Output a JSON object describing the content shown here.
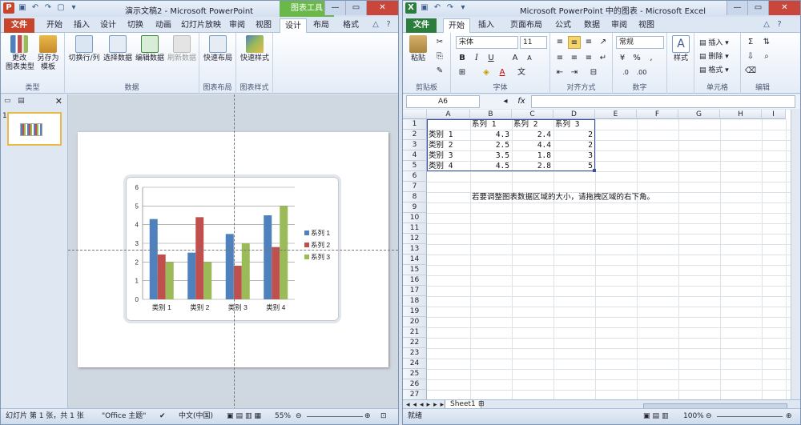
{
  "ppt": {
    "title": "演示文稿2 - Microsoft PowerPoint",
    "context_tab": "图表工具",
    "tabs": [
      "文件",
      "开始",
      "插入",
      "设计",
      "切换",
      "动画",
      "幻灯片放映",
      "审阅",
      "视图",
      "设计",
      "布局",
      "格式"
    ],
    "selected_tab_index": 9,
    "groups": {
      "type": {
        "label": "类型",
        "btn1": "更改\n图表类型",
        "btn2": "另存为\n模板"
      },
      "data": {
        "label": "数据",
        "btn1": "切换行/列",
        "btn2": "选择数据",
        "btn3": "编辑数据",
        "btn4": "刷新数据"
      },
      "layout": {
        "label": "图表布局",
        "btn1": "快速布局"
      },
      "style": {
        "label": "图表样式",
        "btn1": "快速样式"
      }
    },
    "slide_number": "1",
    "status": {
      "slide": "幻灯片 第 1 张，共 1 张",
      "theme": "\"Office 主题\"",
      "lang": "中文(中国)",
      "zoom": "55%"
    }
  },
  "xl": {
    "title": "Microsoft PowerPoint 中的图表 - Microsoft Excel",
    "tabs": [
      "文件",
      "开始",
      "插入",
      "页面布局",
      "公式",
      "数据",
      "审阅",
      "视图"
    ],
    "selected_tab_index": 1,
    "font_name": "宋体",
    "font_size": "11",
    "number_format": "常规",
    "groups": {
      "clipboard": "剪贴板",
      "font": "字体",
      "align": "对齐方式",
      "number": "数字",
      "style_btn": "样式",
      "cells": "单元格",
      "editing": "编辑",
      "paste": "粘贴",
      "insert": "插入",
      "delete": "删除",
      "format": "格式"
    },
    "name_box": "A6",
    "fx": "fx",
    "columns": [
      "A",
      "B",
      "C",
      "D",
      "E",
      "F",
      "G",
      "H",
      "I"
    ],
    "rows": [
      "1",
      "2",
      "3",
      "4",
      "5",
      "6",
      "7",
      "8",
      "9",
      "10",
      "11",
      "12",
      "13",
      "14",
      "15",
      "16",
      "17",
      "18",
      "19",
      "20",
      "21",
      "22",
      "23",
      "24",
      "25",
      "26",
      "27"
    ],
    "cells": {
      "B1": "系列 1",
      "C1": "系列 2",
      "D1": "系列 3",
      "A2": "类别 1",
      "B2": "4.3",
      "C2": "2.4",
      "D2": "2",
      "A3": "类别 2",
      "B3": "2.5",
      "C3": "4.4",
      "D3": "2",
      "A4": "类别 3",
      "B4": "3.5",
      "C4": "1.8",
      "D4": "3",
      "A5": "类别 4",
      "B5": "4.5",
      "C5": "2.8",
      "D5": "5",
      "B8": "若要调整图表数据区域的大小，请拖拽区域的右下角。"
    },
    "sheet_tab": "Sheet1",
    "status": {
      "ready": "就绪",
      "zoom": "100%"
    }
  },
  "chart_data": {
    "type": "bar",
    "categories": [
      "类别 1",
      "类别 2",
      "类别 3",
      "类别 4"
    ],
    "series": [
      {
        "name": "系列 1",
        "values": [
          4.3,
          2.5,
          3.5,
          4.5
        ],
        "color": "#4f81bd"
      },
      {
        "name": "系列 2",
        "values": [
          2.4,
          4.4,
          1.8,
          2.8
        ],
        "color": "#c0504d"
      },
      {
        "name": "系列 3",
        "values": [
          2,
          2,
          3,
          5
        ],
        "color": "#9bbb59"
      }
    ],
    "ylim": [
      0,
      6
    ],
    "yticks": [
      "0",
      "1",
      "2",
      "3",
      "4",
      "5",
      "6"
    ],
    "grid": true,
    "legend": "right"
  },
  "colors": {
    "ppt_file": "#c8442a",
    "xl_file": "#2a7d3b",
    "ctx": "#6ab84a"
  }
}
